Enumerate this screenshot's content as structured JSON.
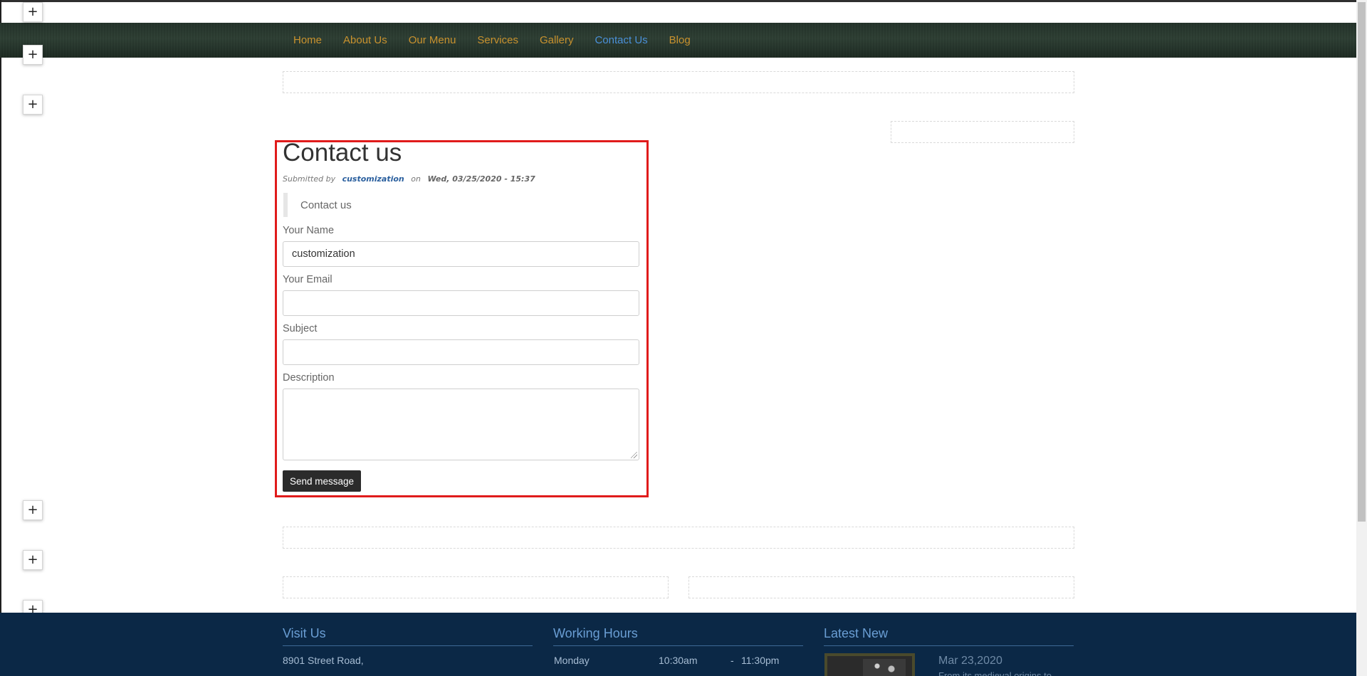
{
  "nav": {
    "items": [
      {
        "label": "Home",
        "active": false
      },
      {
        "label": "About Us",
        "active": false
      },
      {
        "label": "Our Menu",
        "active": false
      },
      {
        "label": "Services",
        "active": false
      },
      {
        "label": "Gallery",
        "active": false
      },
      {
        "label": "Contact Us",
        "active": true
      },
      {
        "label": "Blog",
        "active": false
      }
    ]
  },
  "editor": {
    "add_symbol": "+"
  },
  "content": {
    "title": "Contact us",
    "submitted_prefix": "Submitted by",
    "author": "customization",
    "on_word": "on",
    "date": "Wed, 03/25/2020 - 15:37",
    "quote": "Contact us"
  },
  "form": {
    "name_label": "Your Name",
    "name_value": "customization",
    "email_label": "Your Email",
    "email_value": "",
    "subject_label": "Subject",
    "subject_value": "",
    "description_label": "Description",
    "submit_label": "Send message"
  },
  "footer": {
    "visit_heading": "Visit Us",
    "address_line1": "8901 Street Road,",
    "hours_heading": "Working Hours",
    "hours_day": "Monday",
    "hours_open": "10:30am",
    "hours_dash": "-",
    "hours_close": "11:30pm",
    "news_heading": "Latest New",
    "news_date": "Mar 23,2020",
    "news_snippet": "From its medieval origins to"
  },
  "colors": {
    "nav_link": "#c9922e",
    "nav_active": "#4a90d9",
    "highlight": "#e01b1b",
    "footer_bg": "#0b2846"
  }
}
